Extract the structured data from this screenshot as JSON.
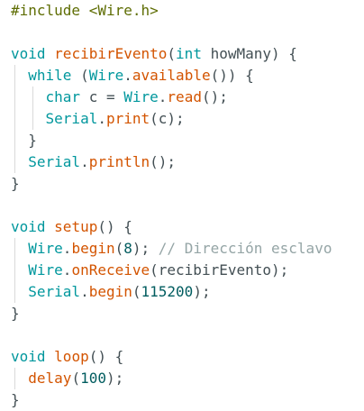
{
  "code": {
    "line_1": {
      "directive": "#include",
      "header": "<Wire.h>"
    },
    "line_3": {
      "type": "void",
      "name": "recibirEvento",
      "open": "(",
      "param_type": "int",
      "param_name": "howMany",
      "close": ") {"
    },
    "line_4": {
      "kw": "while",
      "a": "(",
      "obj": "Wire",
      "dot": ".",
      "method": "available",
      "b": "()) {"
    },
    "line_5": {
      "type": "char",
      "rest": "c =",
      "obj": "Wire",
      "dot": ".",
      "method": "read",
      "end": "();"
    },
    "line_6": {
      "obj": "Serial",
      "dot": ".",
      "method": "print",
      "end": "(c);"
    },
    "line_7": {
      "text": "}"
    },
    "line_8": {
      "obj": "Serial",
      "dot": ".",
      "method": "println",
      "end": "();"
    },
    "line_9": {
      "text": "}"
    },
    "line_11": {
      "type": "void",
      "name": "setup",
      "end": "() {"
    },
    "line_12": {
      "obj": "Wire",
      "dot": ".",
      "method": "begin",
      "open": "(",
      "num": "8",
      "close": ");",
      "comment": "// Dirección esclavo"
    },
    "line_13": {
      "obj": "Wire",
      "dot": ".",
      "method": "onReceive",
      "rest": "(recibirEvento);"
    },
    "line_14": {
      "obj": "Serial",
      "dot": ".",
      "method": "begin",
      "open": "(",
      "num": "115200",
      "close": ");"
    },
    "line_15": {
      "text": "}"
    },
    "line_17": {
      "type": "void",
      "name": "loop",
      "end": "() {"
    },
    "line_18": {
      "method": "delay",
      "open": "(",
      "num": "100",
      "close": ");"
    },
    "line_19": {
      "text": "}"
    }
  },
  "colors": {
    "keyword": "#00979d",
    "preprocessor": "#5e6d03",
    "function": "#d35400",
    "number": "#005c5f",
    "comment": "#95a5a6",
    "plain": "#434f54",
    "indent_guide": "#d9d9d9"
  }
}
